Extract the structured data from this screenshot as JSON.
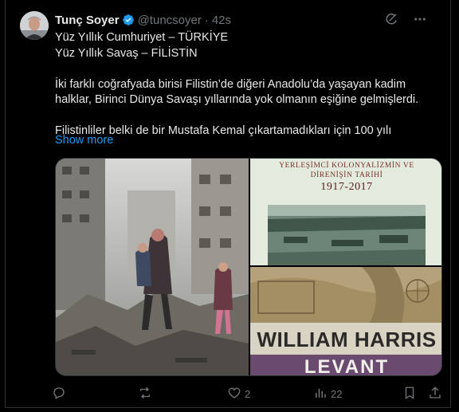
{
  "author": {
    "name": "Tunç Soyer",
    "handle": "@tuncsoyer",
    "separator": "·",
    "time": "42s"
  },
  "post": {
    "lines": [
      "Yüz Yıllık Cumhuriyet – TÜRKİYE",
      "Yüz Yıllık Savaş – FİLİSTİN",
      "",
      "İki farklı coğrafyada birisi Filistin’de diğeri Anadolu’da yaşayan kadim",
      "halklar, Birinci Dünya Savaşı yıllarında yok olmanın eşiğine gelmişlerdi.",
      "",
      "Filistinliler belki de bir Mustafa Kemal çıkartamadıkları için 100 yılı"
    ],
    "show_more": "Show more"
  },
  "media": {
    "book1": {
      "title_line1": "YERLEŞİMCİ KOLONYALİZMİN VE",
      "title_line2": "DİRENİŞİN TARİHİ",
      "years": "1917-2017"
    },
    "book2": {
      "author": "WILLIAM HARRIS",
      "title": "LEVANT"
    }
  },
  "actions": {
    "reply_count": "",
    "repost_count": "",
    "like_count": "2",
    "views_count": "22"
  },
  "icons": {
    "verified": "verified-badge-icon",
    "grok": "grok-icon",
    "more": "more-icon",
    "reply": "reply-icon",
    "repost": "repost-icon",
    "like": "heart-icon",
    "views": "views-icon",
    "bookmark": "bookmark-icon",
    "share": "share-icon"
  },
  "colors": {
    "background": "#000000",
    "text": "#e7e9ea",
    "muted": "#71767b",
    "link": "#1d9bf0",
    "border": "#2f3336"
  }
}
